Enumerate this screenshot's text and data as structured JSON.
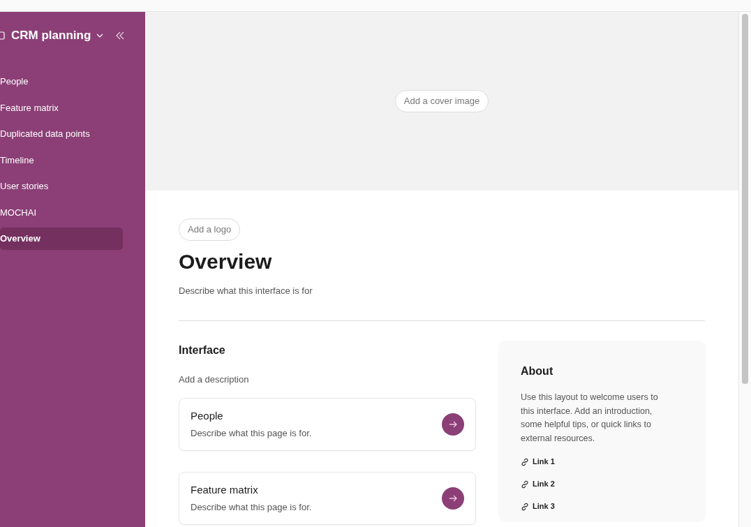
{
  "sidebar": {
    "title": "CRM planning",
    "items": [
      {
        "label": "People",
        "selected": false
      },
      {
        "label": "Feature matrix",
        "selected": false
      },
      {
        "label": "Duplicated data points",
        "selected": false
      },
      {
        "label": "Timeline",
        "selected": false
      },
      {
        "label": "User stories",
        "selected": false
      },
      {
        "label": "MOCHAI",
        "selected": false
      },
      {
        "label": "Overview",
        "selected": true
      }
    ]
  },
  "cover": {
    "button": "Add a cover image"
  },
  "logo_button": "Add a logo",
  "title": "Overview",
  "description": "Describe what this interface is for",
  "interface": {
    "heading": "Interface",
    "description": "Add a description",
    "pages": [
      {
        "title": "People",
        "description": "Describe what this page is for."
      },
      {
        "title": "Feature matrix",
        "description": "Describe what this page is for."
      }
    ]
  },
  "about": {
    "heading": "About",
    "text": "Use this layout to welcome users to this interface. Add an introduction, some helpful tips, or quick links to external resources.",
    "links": [
      "Link 1",
      "Link 2",
      "Link 3"
    ]
  }
}
